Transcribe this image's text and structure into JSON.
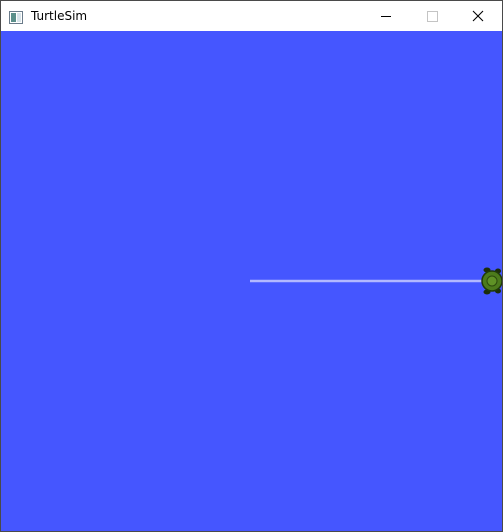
{
  "window": {
    "title": "TurtleSim"
  },
  "titlebar_buttons": {
    "minimize_icon": "minimize-icon",
    "maximize_icon": "maximize-icon",
    "close_icon": "close-icon"
  },
  "canvas": {
    "background_color": "#4556ff",
    "pen_color": "#b3b8ff",
    "turtle_icon": "turtle-icon"
  }
}
